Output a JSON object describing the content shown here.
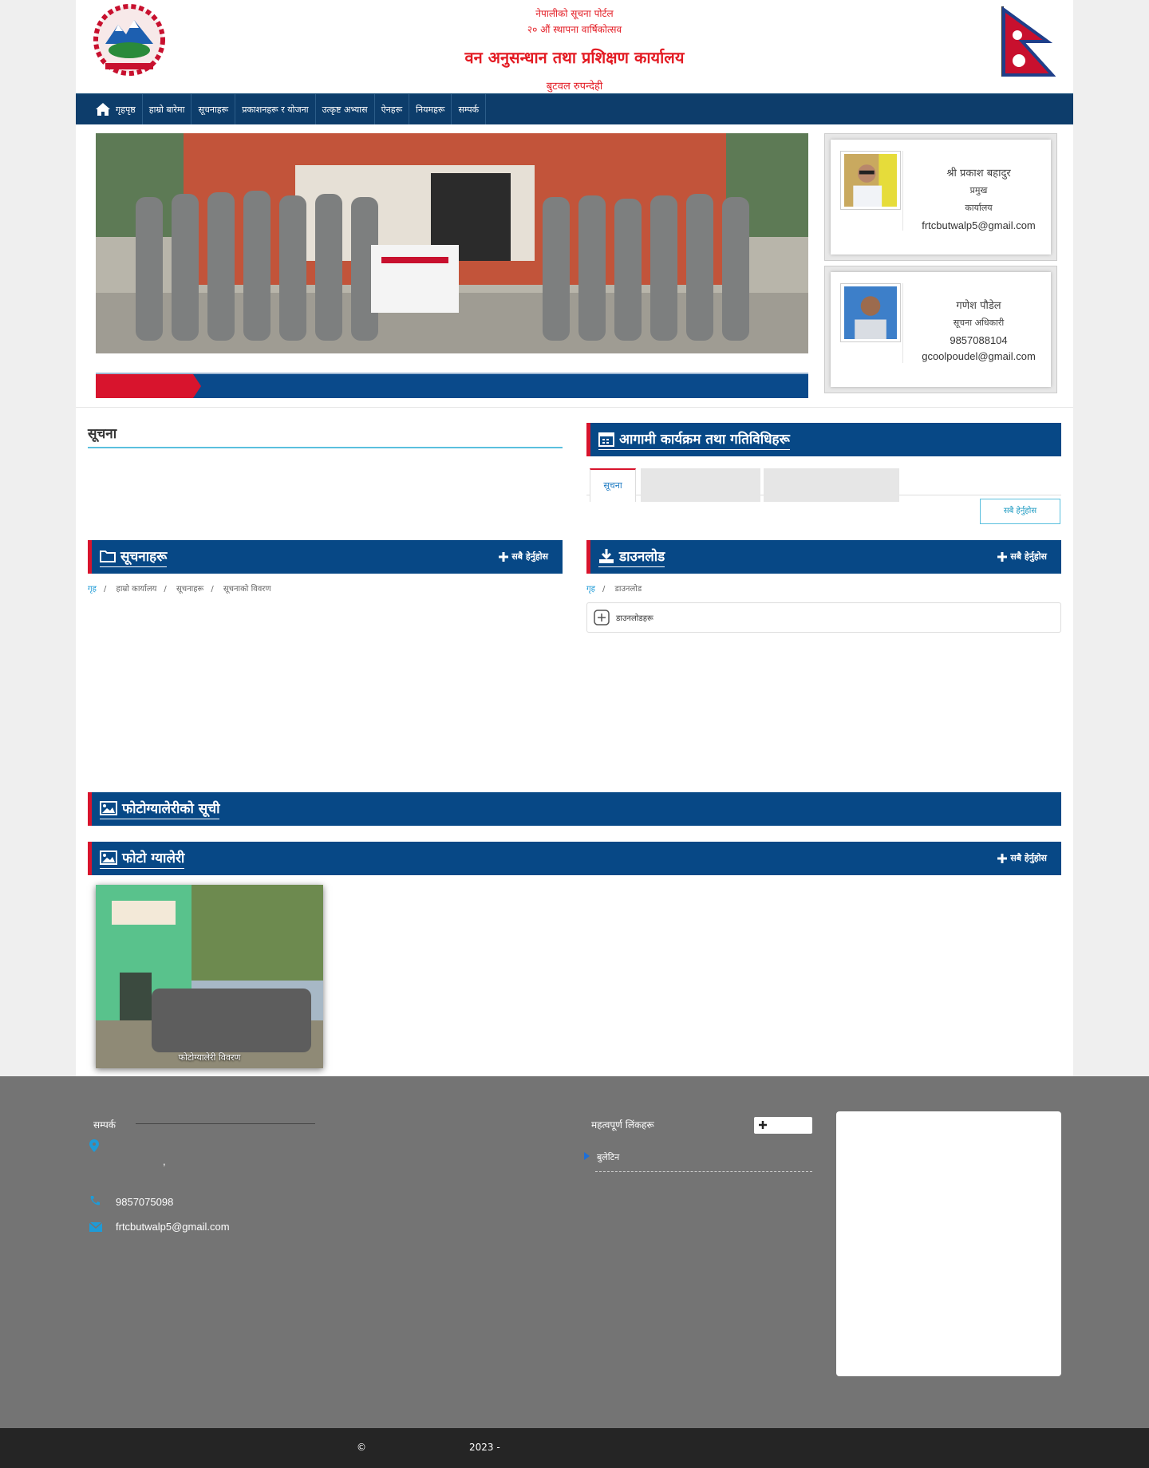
{
  "header": {
    "line1": "नेपालीको सूचना पोर्टल",
    "line2": "२० औं स्थापना वार्षिकोत्सव",
    "line3": "वन अनुसन्धान तथा प्रशिक्षण कार्यालय",
    "line4": "बुटवल रुपन्देही"
  },
  "nav": {
    "items": [
      "गृहपृष्ठ",
      "हाम्रो बारेमा",
      "सूचनाहरू",
      "प्रकाशनहरू र योजना",
      "उत्कृष्ट अभ्यास",
      "ऐनहरू",
      "नियमहरू",
      "सम्पर्क"
    ]
  },
  "people": [
    {
      "name": "श्री प्रकाश बहादुर",
      "role": "प्रमुख",
      "role2": "कार्यालय",
      "contact": "frtcbutwalp5@gmail.com"
    },
    {
      "name": "गणेश पौडेल",
      "role": "सूचना अधिकारी",
      "phone": "9857088104",
      "contact": "gcoolpoudel@gmail.com"
    }
  ],
  "mid": {
    "news_title": "सूचना",
    "events_title": "आगामी कार्यक्रम तथा गतिविधिहरू",
    "events_tab": "सूचना",
    "events_all": "सबै हेर्नुहोस",
    "docs_title": "सूचनाहरू",
    "docs_more": "सबै हेर्नुहोस",
    "docs_crumb": [
      "गृह",
      "हाम्रो कार्यालय",
      "सूचनाहरू",
      "सूचनाको विवरण"
    ],
    "dl_title": "डाउनलोड",
    "dl_more": "सबै हेर्नुहोस",
    "dl_crumb": [
      "गृह",
      "डाउनलोड"
    ],
    "dl_item": "डाउनलोडहरू",
    "photo_title": "फोटोग्यालेरीको सूची",
    "gal_title": "फोटो ग्यालेरी",
    "gal_more": "सबै हेर्नुहोस",
    "gal_caption": "फोटोग्यालेरी विवरण"
  },
  "footer": {
    "contact_title": "सम्पर्क",
    "address_sep": ",",
    "phone": "9857075098",
    "email": "frtcbutwalp5@gmail.com",
    "links_title": "महत्वपूर्ण लिंकहरू",
    "link1": "बुलेटिन",
    "copyright": "©",
    "year": "2023 -"
  },
  "colors": {
    "brand_blue": "#074886",
    "accent_red": "#d8142d",
    "nav_blue": "#0d3d6b"
  },
  "icons": [
    "home-icon",
    "calendar-icon",
    "folder-icon",
    "download-icon",
    "image-icon",
    "plus-icon",
    "map-marker-icon",
    "phone-icon",
    "envelope-icon",
    "caret-right-icon"
  ]
}
